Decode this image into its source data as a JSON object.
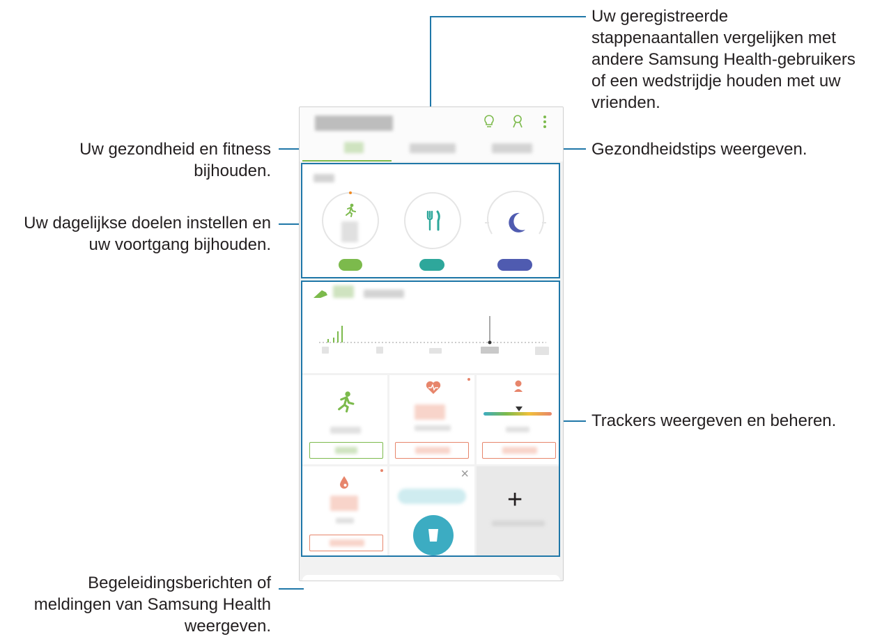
{
  "callouts": {
    "compare_steps": [
      "Uw geregistreerde",
      "stappenaantallen vergelijken met",
      "andere Samsung Health-gebruikers",
      "of een wedstrijdje houden met uw",
      "vrienden."
    ],
    "health_tips": "Gezondheidstips weergeven.",
    "track_health": [
      "Uw gezondheid en fitness",
      "bijhouden."
    ],
    "daily_goals": [
      "Uw dagelijkse doelen instellen en",
      "uw voortgang bijhouden."
    ],
    "trackers": "Trackers weergeven en beheren.",
    "notifications": [
      "Begeleidingsberichten of",
      "meldingen van Samsung Health",
      "weergeven."
    ]
  },
  "icons": {
    "tips": "lightbulb-icon",
    "together": "people-icon",
    "more": "more-vertical-icon",
    "steps": "running-icon",
    "food": "fork-knife-icon",
    "sleep": "moon-icon",
    "heart": "heart-rate-icon",
    "weight": "person-weight-icon",
    "blood": "drop-icon",
    "water": "cup-icon",
    "add": "plus-icon",
    "bell": "bell-icon",
    "expand": "chevron-up-icon"
  },
  "colors": {
    "callout_line": "#1f77a8",
    "steps_green": "#7cba4c",
    "food_teal": "#2ea79b",
    "sleep_indigo": "#4f5bb0",
    "alert_orange": "#e7856b",
    "water_blue": "#3cacc2"
  },
  "symbols": {
    "close": "×",
    "plus": "+",
    "chevron_up": "⌃"
  }
}
